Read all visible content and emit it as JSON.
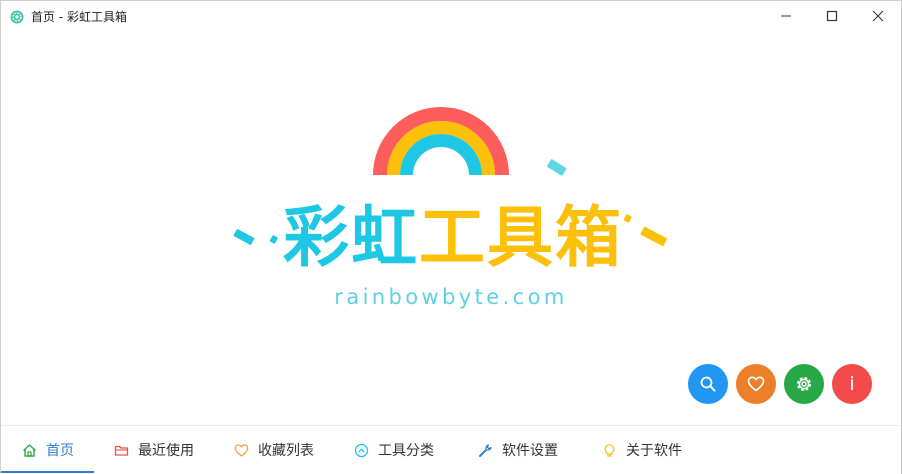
{
  "window": {
    "title": "首页 - 彩虹工具箱",
    "icon": "gear-icon",
    "controls": [
      "minimize-icon",
      "maximize-icon",
      "close-icon"
    ]
  },
  "logo": {
    "title_part1": "彩虹",
    "title_part2": "工具箱",
    "url": "rainbowbyte.com",
    "colors": {
      "rainbow_outer": "#fd5e5c",
      "rainbow_middle": "#fcbf0a",
      "rainbow_inner": "#1ec8e4",
      "title_cyan": "#1ec8e4",
      "title_yellow": "#fcbf0a"
    }
  },
  "fabs": [
    {
      "name": "search",
      "icon": "search-icon",
      "color": "#2196f3"
    },
    {
      "name": "favorite",
      "icon": "heart-icon",
      "color": "#ec7f2a"
    },
    {
      "name": "settings",
      "icon": "gear-icon",
      "color": "#28a745"
    },
    {
      "name": "info",
      "icon": "info-icon",
      "label": "i",
      "color": "#f44a4a"
    }
  ],
  "nav": {
    "active_color": "#2f80d1",
    "items": [
      {
        "label": "首页",
        "icon": "home-icon",
        "icon_color": "#28a745",
        "active": true
      },
      {
        "label": "最近使用",
        "icon": "folder-icon",
        "icon_color": "#f44a4a"
      },
      {
        "label": "收藏列表",
        "icon": "heart-icon",
        "icon_color": "#f0a030"
      },
      {
        "label": "工具分类",
        "icon": "chevron-up-circle-icon",
        "icon_color": "#1ec8e4"
      },
      {
        "label": "软件设置",
        "icon": "wrench-icon",
        "icon_color": "#2f80d1"
      },
      {
        "label": "关于软件",
        "icon": "lightbulb-icon",
        "icon_color": "#fcbf0a"
      }
    ]
  }
}
